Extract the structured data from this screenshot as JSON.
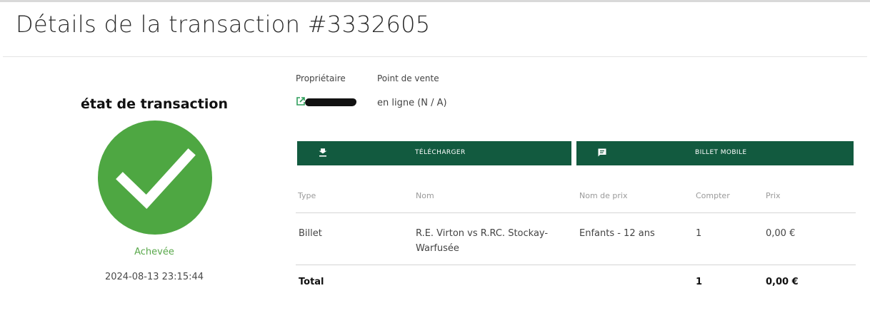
{
  "header": {
    "title": "Détails de la transaction #3332605"
  },
  "status": {
    "heading": "état de transaction",
    "icon": "check-icon",
    "state": "Achevée",
    "datetime": "2024-08-13 23:15:44",
    "color": "#4ea742"
  },
  "info": {
    "owner_label": "Propriétaire",
    "sale_point_label": "Point de vente",
    "sale_point_value": "en ligne (N / A)"
  },
  "actions": {
    "download_label": "TÉLÉCHARGER",
    "download_icon": "download-icon",
    "mobile_label": "BILLET MOBILE",
    "mobile_icon": "message-icon",
    "color": "#125a3f"
  },
  "table": {
    "columns": [
      "Type",
      "Nom",
      "Nom de prix",
      "Compter",
      "Prix"
    ],
    "rows": [
      {
        "type": "Billet",
        "name": "R.E. Virton vs R.RC. Stockay-Warfusée",
        "price_name": "Enfants - 12 ans",
        "count": "1",
        "price": "0,00 €"
      }
    ],
    "total": {
      "label": "Total",
      "count": "1",
      "price": "0,00 €"
    }
  }
}
